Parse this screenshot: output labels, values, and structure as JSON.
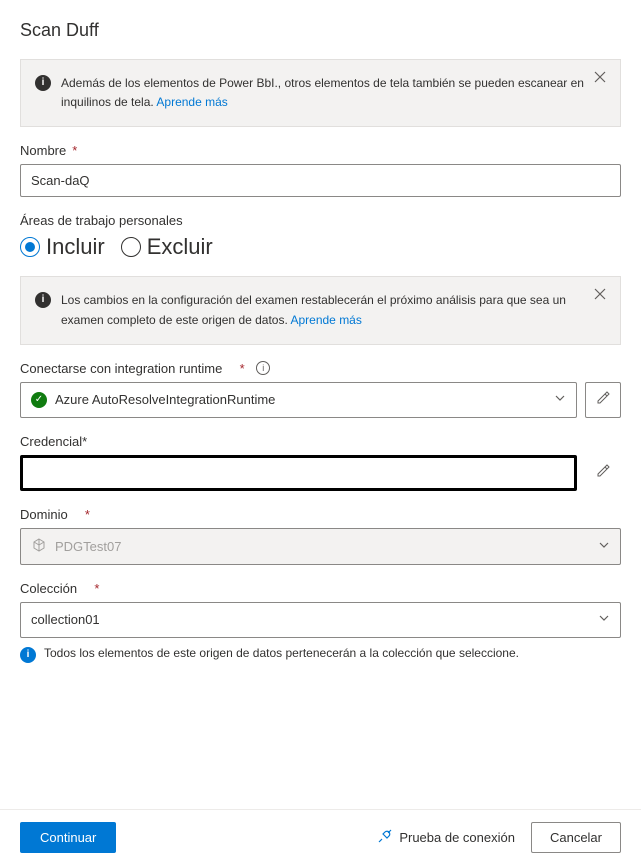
{
  "title": "Scan Duff",
  "infoBox1": {
    "text": "Además de los elementos de Power BbI., otros elementos de tela también se pueden escanear en inquilinos de tela. ",
    "link": "Aprende más"
  },
  "nameField": {
    "label": "Nombre",
    "value": "Scan-daQ"
  },
  "workspaces": {
    "label": "Áreas de trabajo personales",
    "include": "Incluir",
    "exclude": "Excluir"
  },
  "infoBox2": {
    "text": "Los cambios en la configuración del examen restablecerán el próximo análisis para que sea un examen completo de este origen de datos. ",
    "link": "Aprende más"
  },
  "runtime": {
    "label": "Conectarse con integration runtime",
    "value": "Azure AutoResolveIntegrationRuntime"
  },
  "credential": {
    "label": "Credencial*",
    "value": ""
  },
  "domain": {
    "label": "Dominio",
    "value": "PDGTest07"
  },
  "collection": {
    "label": "Colección",
    "value": "collection01",
    "helper": "Todos los elementos de este origen de datos pertenecerán a la colección que seleccione."
  },
  "footer": {
    "continue": "Continuar",
    "testConnection": "Prueba de conexión",
    "cancel": "Cancelar"
  }
}
